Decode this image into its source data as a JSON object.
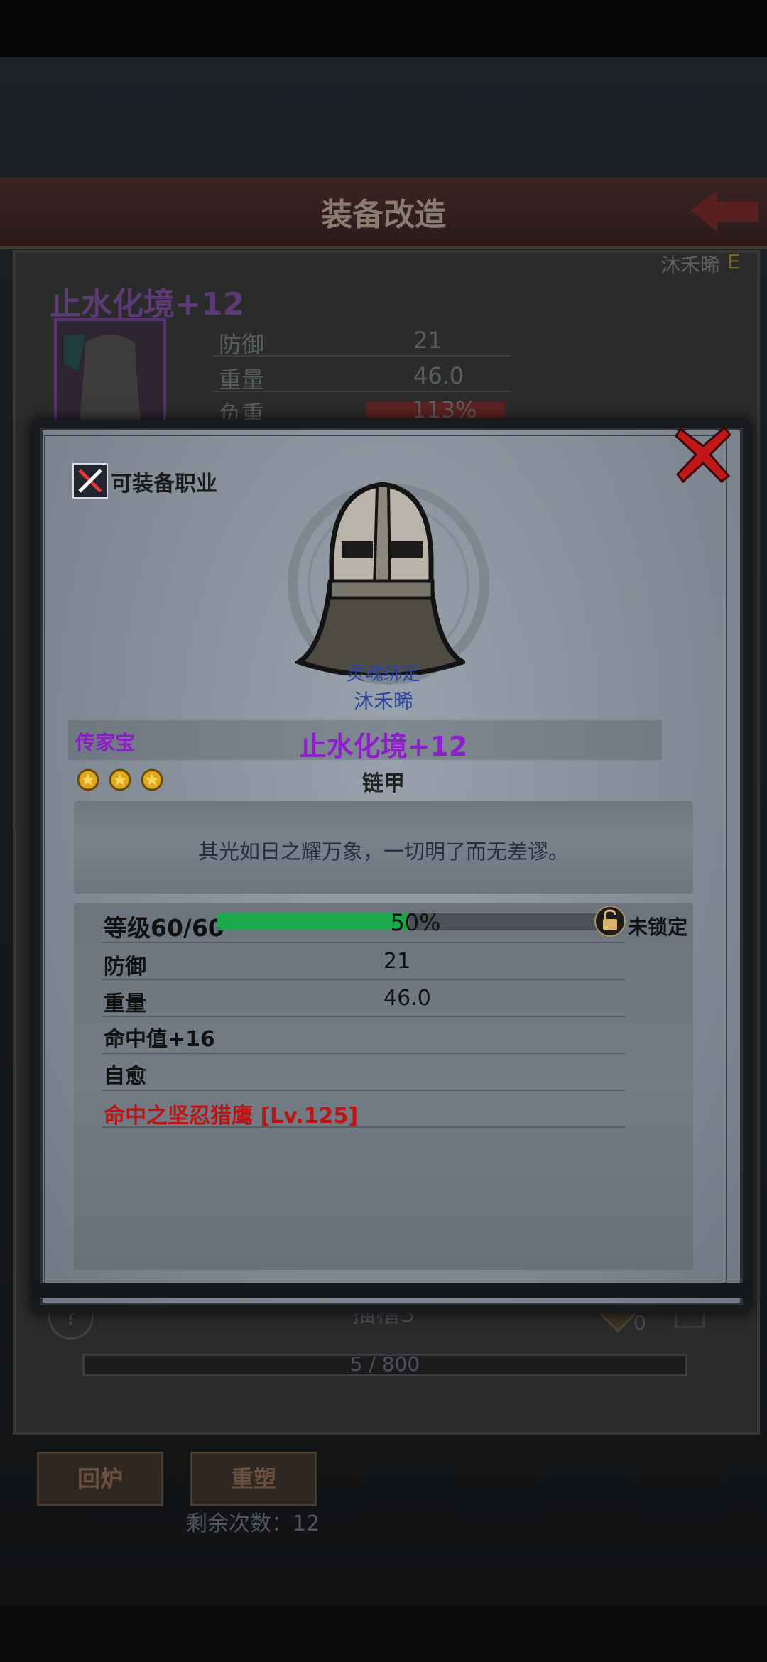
{
  "background": {
    "title": "装备改造",
    "owner": "沐禾晞",
    "owner_tier": "E",
    "item_name": "止水化境+12",
    "stats": [
      {
        "label": "防御",
        "value": "21"
      },
      {
        "label": "重量",
        "value": "46.0"
      },
      {
        "label": "负重",
        "value": "113%"
      }
    ],
    "slot_label": "插槽3",
    "help_symbol": "?",
    "gem_count": "0",
    "progress_text": "5 / 800",
    "buttons": {
      "recycle": "回炉",
      "reforge": "重塑"
    },
    "remaining": "剩余次数：12"
  },
  "modal": {
    "job_label": "可装备职业",
    "soulbound": "灵魂绑定",
    "owner": "沐禾晞",
    "rarity": "传家宝",
    "item_name": "止水化境+12",
    "stars": 3,
    "item_type": "链甲",
    "description": "其光如日之耀万象，一切明了而无差谬。",
    "level_label": "等级60/60",
    "xp_percent": 50,
    "xp_text": "50%",
    "lock_label": "未锁定",
    "stats": [
      {
        "label": "防御",
        "value": "21"
      },
      {
        "label": "重量",
        "value": "46.0"
      }
    ],
    "affixes": [
      "命中值+16",
      "自愈"
    ],
    "skill": "命中之坚忍猎鹰 [Lv.125]"
  },
  "colors": {
    "rarity": "#8f1ecf",
    "skill": "#c01414",
    "xp_fill": "#1aa84a",
    "close": "#c01818"
  }
}
